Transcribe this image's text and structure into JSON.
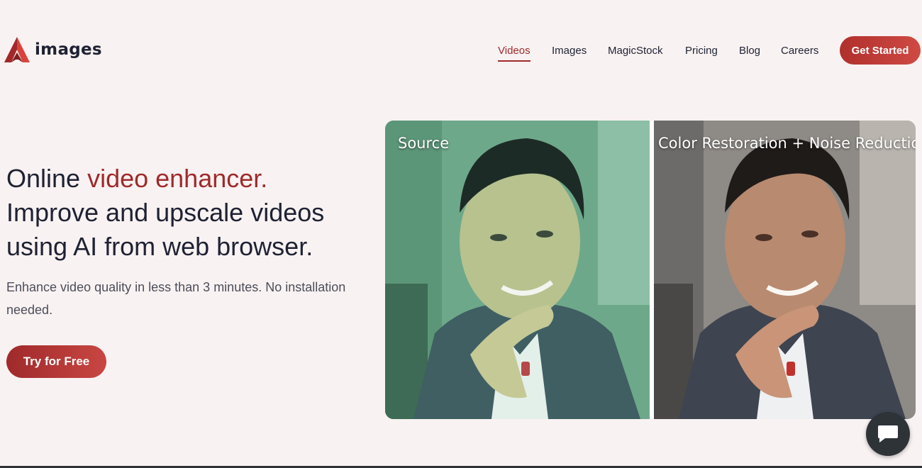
{
  "brand": {
    "name": "images"
  },
  "nav": {
    "items": [
      {
        "label": "Videos",
        "active": true
      },
      {
        "label": "Images",
        "active": false
      },
      {
        "label": "MagicStock",
        "active": false
      },
      {
        "label": "Pricing",
        "active": false
      },
      {
        "label": "Blog",
        "active": false
      },
      {
        "label": "Careers",
        "active": false
      }
    ],
    "cta_label": "Get Started"
  },
  "hero": {
    "title_line1_prefix": "Online ",
    "title_line1_accent": "video enhancer.",
    "title_line2": "Improve and upscale videos",
    "title_line3": "using AI from web browser.",
    "subtitle": "Enhance video quality in less than 3 minutes. No installation needed.",
    "cta_label": "Try for Free"
  },
  "comparison": {
    "left_label": "Source",
    "right_label": "Color Restoration + Noise Reduction"
  },
  "colors": {
    "accent": "#9e2a2b",
    "background": "#f9f2f2",
    "text": "#1e2233",
    "chat_button": "#2e3338"
  },
  "icons": {
    "logo": "logo-mark-icon",
    "chat": "chat-bubble-icon"
  }
}
